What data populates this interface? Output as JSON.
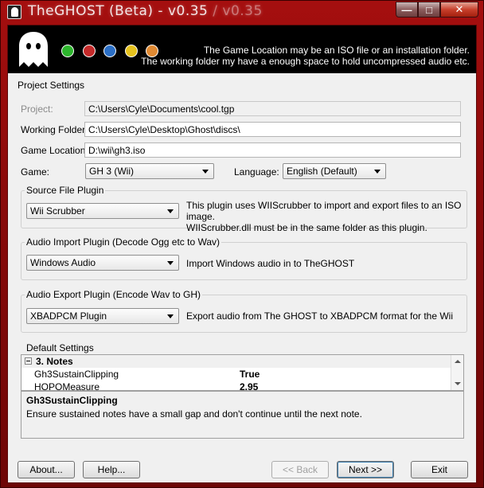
{
  "window": {
    "title": "TheGHOST (Beta) - v0.35",
    "title_ghost": " / v0.35",
    "controls": {
      "minimize": "—",
      "maximize": "□",
      "close": "✕"
    }
  },
  "banner": {
    "dot_colors": [
      "#2db52d",
      "#c42a2a",
      "#2b6fc6",
      "#e6c21e",
      "#e08a33"
    ],
    "line1": "The Game Location may be an ISO file or an installation folder.",
    "line2": "The working folder my have a enough space to hold uncompressed audio etc."
  },
  "project": {
    "section_title": "Project Settings",
    "project_label": "Project:",
    "project_value": "C:\\Users\\Cyle\\Documents\\cool.tgp",
    "working_label": "Working Folder:",
    "working_value": "C:\\Users\\Cyle\\Desktop\\Ghost\\discs\\",
    "location_label": "Game Location:",
    "location_value": "D:\\wii\\gh3.iso",
    "game_label": "Game:",
    "game_value": "GH 3 (Wii)",
    "language_label": "Language:",
    "language_value": "English (Default)"
  },
  "source_plugin": {
    "title": "Source File Plugin",
    "value": "Wii Scrubber",
    "desc1": "This plugin uses WIIScrubber to import and export files to an ISO image.",
    "desc2": "WIIScrubber.dll must be in the same folder as this plugin."
  },
  "import_plugin": {
    "title": "Audio Import Plugin (Decode Ogg etc to Wav)",
    "value": "Windows Audio",
    "desc": "Import Windows audio in to TheGHOST"
  },
  "export_plugin": {
    "title": "Audio Export Plugin (Encode Wav to GH)",
    "value": "XBADPCM Plugin",
    "desc": "Export audio from The GHOST to XBADPCM format for the Wii"
  },
  "defaults": {
    "title": "Default Settings",
    "category": "3. Notes",
    "rows": [
      {
        "name": "Gh3SustainClipping",
        "value": "True"
      },
      {
        "name": "HOPOMeasure",
        "value": "2.95"
      }
    ],
    "help_title": "Gh3SustainClipping",
    "help_text": "Ensure sustained notes have a small gap and don't continue until the next note."
  },
  "buttons": {
    "about": "About...",
    "help": "Help...",
    "back": "<< Back",
    "next": "Next >>",
    "exit": "Exit"
  }
}
